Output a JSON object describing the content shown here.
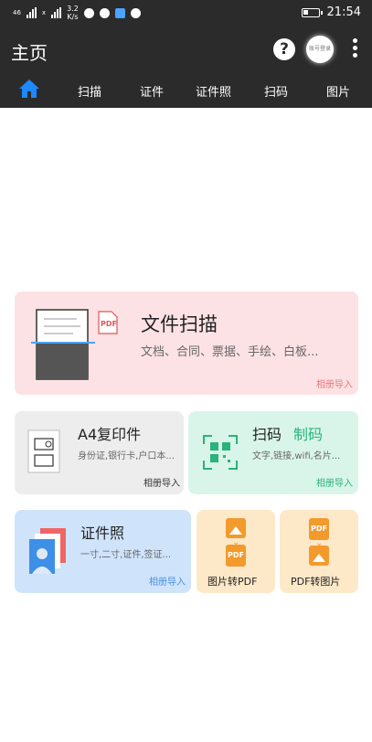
{
  "status": {
    "signal1": "46",
    "signal2": "x",
    "speed_value": "3.2",
    "speed_unit": "K/s",
    "time": "21:54"
  },
  "appbar": {
    "title": "主页",
    "help_icon": "question-circle-icon",
    "avatar_text": "账号登录",
    "more_icon": "vertical-dots-icon"
  },
  "tabs": [
    {
      "label": "",
      "icon": "home-icon",
      "active": true
    },
    {
      "label": "扫描"
    },
    {
      "label": "证件"
    },
    {
      "label": "证件照"
    },
    {
      "label": "扫码"
    },
    {
      "label": "图片"
    }
  ],
  "colors": {
    "accent": "#1e88ff",
    "scan_card": "#fde2e5",
    "a4_card": "#ededed",
    "qr_card": "#d9f5e9",
    "id_card": "#cfe3fa",
    "convert_card": "#fde8c8"
  },
  "cards": {
    "scan": {
      "title": "文件扫描",
      "subtitle": "文档、合同、票据、手绘、白板...",
      "import": "相册导入",
      "pdf_label": "PDF"
    },
    "a4": {
      "title": "A4复印件",
      "subtitle": "身份证,银行卡,户口本...",
      "import": "相册导入"
    },
    "qr": {
      "title": "扫码",
      "title2": "制码",
      "subtitle": "文字,链接,wifi,名片...",
      "import": "相册导入"
    },
    "idphoto": {
      "title": "证件照",
      "subtitle": "一寸,二寸,证件,签证...",
      "import": "相册导入"
    },
    "img2pdf": {
      "title": "图片转PDF",
      "pdf_label": "PDF"
    },
    "pdf2img": {
      "title": "PDF转图片",
      "pdf_label": "PDF"
    }
  }
}
